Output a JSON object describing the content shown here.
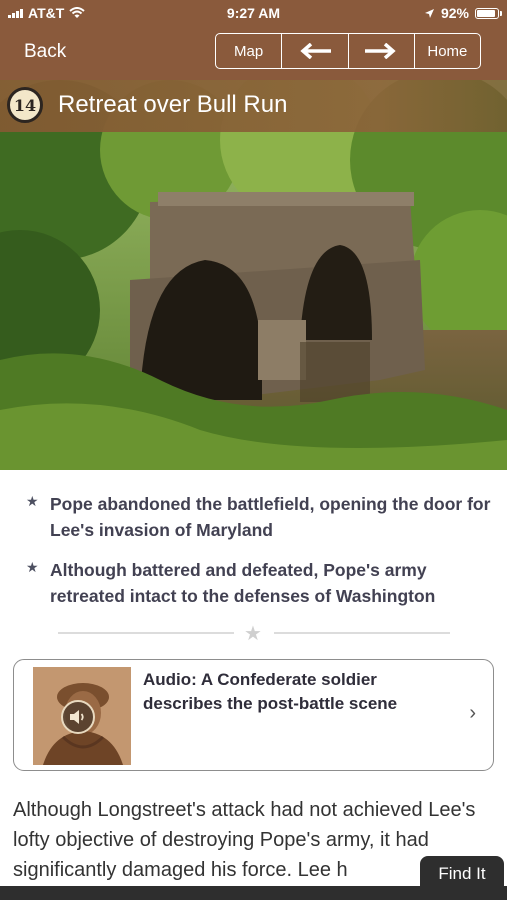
{
  "status_bar": {
    "carrier": "AT&T",
    "time": "9:27 AM",
    "battery_percent": "92%",
    "battery_level": 0.92,
    "icons": [
      "signal-icon",
      "wifi-icon",
      "location-arrow-icon",
      "battery-icon"
    ]
  },
  "nav": {
    "back_label": "Back",
    "map_label": "Map",
    "prev_label": "←",
    "next_label": "→",
    "home_label": "Home"
  },
  "header": {
    "stop_number": "14",
    "title": "Retreat over Bull Run"
  },
  "bullets": [
    {
      "star": "★",
      "text": "Pope abandoned the battlefield, opening the door for Lee's invasion of Maryland"
    },
    {
      "star": "★",
      "text": "Although battered and defeated, Pope's army retreated intact to the defenses of Washington"
    }
  ],
  "divider": {
    "star": "★"
  },
  "audio": {
    "title": "Audio: A Confederate soldier describes the post-battle scene",
    "chevron": "›"
  },
  "body": {
    "text": "Although Longstreet's attack had not achieved Lee's lofty objective of destroying Pope's army, it had significantly damaged his force. Lee h"
  },
  "footer": {
    "find_it_label": "Find It"
  },
  "colors": {
    "nav_brown": "#8a5a3c",
    "text_dark": "#424152",
    "footer_dark": "#2e2e2e"
  }
}
